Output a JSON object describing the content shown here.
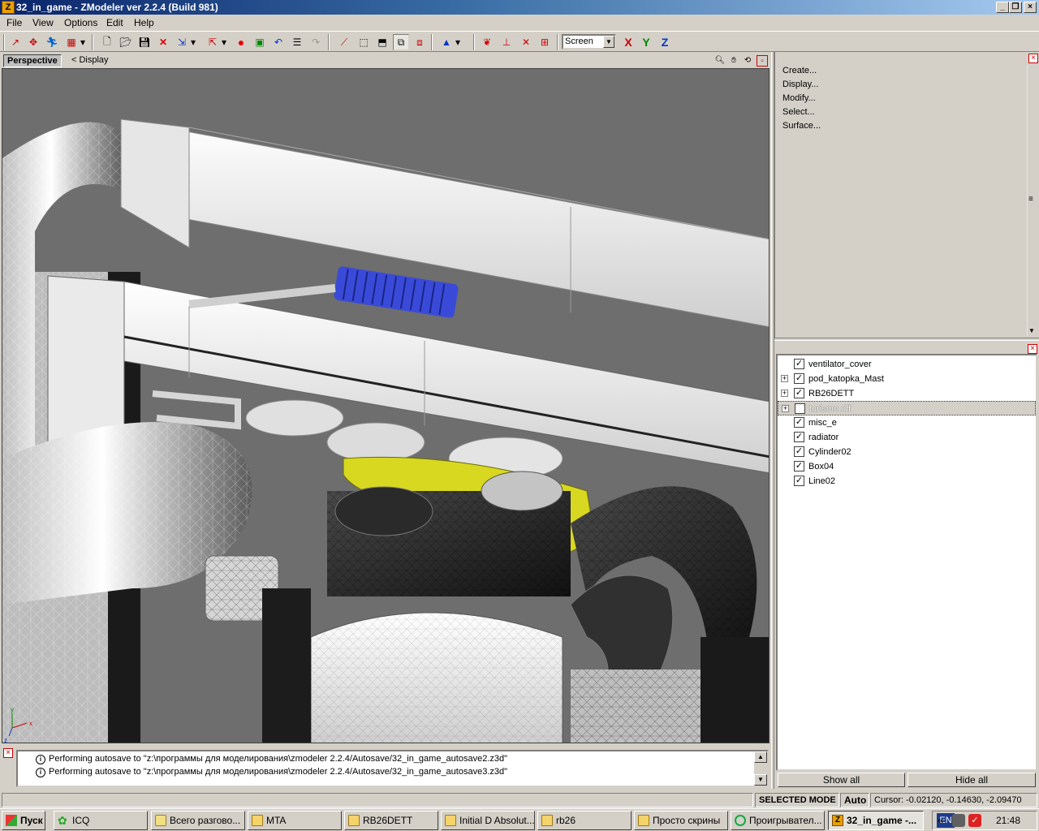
{
  "window": {
    "title": "32_in_game - ZModeler ver 2.2.4 (Build 981)",
    "app_icon": "Z"
  },
  "menu": [
    "File",
    "View",
    "Options",
    "Edit",
    "Help"
  ],
  "toolbar": {
    "view_select": "Screen",
    "axis_x": "X",
    "axis_y": "Y",
    "axis_z": "Z"
  },
  "viewport": {
    "tab": "Perspective",
    "display_label": "<  Display"
  },
  "command_panel": {
    "items": [
      "Create...",
      "Display...",
      "Modify...",
      "Select...",
      "Surface..."
    ]
  },
  "objects": [
    {
      "name": "ventilator_cover",
      "checked": true,
      "expandable": false,
      "selected": false
    },
    {
      "name": "pod_katopka_Mast",
      "checked": true,
      "expandable": true,
      "selected": false
    },
    {
      "name": "RB26DETT",
      "checked": true,
      "expandable": true,
      "selected": false
    },
    {
      "name": "turismo.dff",
      "checked": false,
      "expandable": true,
      "selected": true
    },
    {
      "name": "misc_e",
      "checked": true,
      "expandable": false,
      "selected": false
    },
    {
      "name": "radiator",
      "checked": true,
      "expandable": false,
      "selected": false
    },
    {
      "name": "Cylinder02",
      "checked": true,
      "expandable": false,
      "selected": false
    },
    {
      "name": "Box04",
      "checked": true,
      "expandable": false,
      "selected": false
    },
    {
      "name": "Line02",
      "checked": true,
      "expandable": false,
      "selected": false
    }
  ],
  "object_panel": {
    "show_all": "Show all",
    "hide_all": "Hide all"
  },
  "log": [
    "Performing autosave to \"z:\\программы для моделирования\\zmodeler 2.2.4/Autosave/32_in_game_autosave2.z3d\"",
    "Performing autosave to \"z:\\программы для моделирования\\zmodeler 2.2.4/Autosave/32_in_game_autosave3.z3d\""
  ],
  "status": {
    "mode": "SELECTED MODE",
    "auto": "Auto",
    "cursor": "Cursor: -0.02120, -0.14630, -2.09470"
  },
  "taskbar": {
    "start": "Пуск",
    "tasks": [
      "ICQ",
      "Всего разгово...",
      "MTA",
      "RB26DETT",
      "Initial D Absolut...",
      "rb26",
      "Просто скрины",
      "Проигрывател...",
      "32_in_game -..."
    ],
    "lang": "EN",
    "clock": "21:48"
  },
  "colors": {
    "title_start": "#0a246a",
    "title_end": "#a6caf0",
    "viewport_bg": "#6e6e6e",
    "highlight_blue": "#3a4ad8",
    "highlight_yellow": "#d8d820"
  }
}
